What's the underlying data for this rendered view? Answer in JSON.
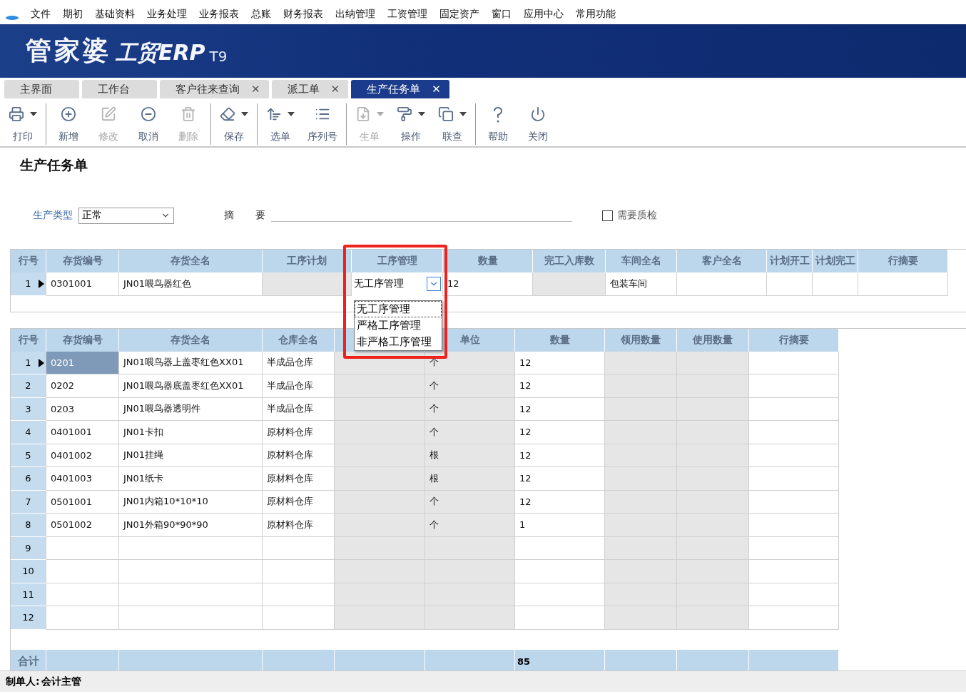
{
  "menu": [
    "文件",
    "期初",
    "基础资料",
    "业务处理",
    "业务报表",
    "总账",
    "财务报表",
    "出纳管理",
    "工资管理",
    "固定资产",
    "窗口",
    "应用中心",
    "常用功能"
  ],
  "banner": {
    "brand": "管家婆",
    "product": "工贸ERP",
    "version": "T9"
  },
  "tabs": [
    {
      "label": "主界面",
      "selected": false
    },
    {
      "label": "工作台",
      "selected": false
    },
    {
      "label": "客户往来查询",
      "selected": false,
      "close": "✕"
    },
    {
      "label": "派工单",
      "selected": false,
      "close": "✕"
    },
    {
      "label": "生产任务单",
      "selected": true,
      "close": "✕"
    }
  ],
  "toolbar": [
    [
      {
        "label": "打印",
        "disabled": false,
        "dropdown": true
      }
    ],
    [
      {
        "label": "新增",
        "disabled": false,
        "dropdown": false
      },
      {
        "label": "修改",
        "disabled": true,
        "dropdown": false
      },
      {
        "label": "取消",
        "disabled": false,
        "dropdown": false
      },
      {
        "label": "删除",
        "disabled": true,
        "dropdown": false
      }
    ],
    [
      {
        "label": "保存",
        "disabled": false,
        "dropdown": true
      }
    ],
    [
      {
        "label": "选单",
        "disabled": false,
        "dropdown": true
      },
      {
        "label": "序列号",
        "disabled": false,
        "dropdown": false
      }
    ],
    [
      {
        "label": "生单",
        "disabled": true,
        "dropdown": true
      },
      {
        "label": "操作",
        "disabled": false,
        "dropdown": true
      },
      {
        "label": "联查",
        "disabled": false,
        "dropdown": true
      }
    ],
    [
      {
        "label": "帮助",
        "disabled": false,
        "dropdown": false
      },
      {
        "label": "关闭",
        "disabled": false,
        "dropdown": false
      }
    ]
  ],
  "page_title": "生产任务单",
  "form": {
    "type_label": "生产类型",
    "type_value": "正常",
    "summary_label_1": "摘",
    "summary_label_2": "要",
    "quality_check": {
      "label": "需要质检",
      "checked": false
    }
  },
  "top_table": {
    "columns": [
      {
        "label": "行号",
        "kind": "no"
      },
      {
        "label": "存货编号",
        "kind": "text"
      },
      {
        "label": "存货全名",
        "kind": "text"
      },
      {
        "label": "工序计划",
        "kind": "readonly"
      },
      {
        "label": "工序管理",
        "kind": "combo"
      },
      {
        "label": "数量",
        "kind": "text"
      },
      {
        "label": "完工入库数",
        "kind": "readonly"
      },
      {
        "label": "车间全名",
        "kind": "text"
      },
      {
        "label": "客户全名",
        "kind": "text"
      },
      {
        "label": "计划开工",
        "kind": "text"
      },
      {
        "label": "计划完工",
        "kind": "text"
      },
      {
        "label": "行摘要",
        "kind": "text"
      }
    ],
    "rows": [
      {
        "current": true,
        "selected": false,
        "cells": [
          "1",
          "0301001",
          "JN01喂鸟器红色",
          "",
          "无工序管理",
          "12",
          "",
          "包装车间",
          "",
          "",
          "",
          ""
        ]
      }
    ],
    "dropdown": [
      {
        "label": "无工序管理",
        "selected": true
      },
      {
        "label": "严格工序管理",
        "selected": false
      },
      {
        "label": "非严格工序管理",
        "selected": false
      }
    ]
  },
  "bottom_table": {
    "columns": [
      {
        "label": "行号",
        "kind": "no"
      },
      {
        "label": "存货编号",
        "kind": "text"
      },
      {
        "label": "存货全名",
        "kind": "text"
      },
      {
        "label": "仓库全名",
        "kind": "text"
      },
      {
        "kind": "readonly"
      },
      {
        "label": "单位",
        "kind": "readonly"
      },
      {
        "label": "数量",
        "kind": "text"
      },
      {
        "label": "领用数量",
        "kind": "readonly"
      },
      {
        "label": "使用数量",
        "kind": "readonly"
      },
      {
        "label": "行摘要",
        "kind": "text"
      }
    ],
    "rows": [
      {
        "current": true,
        "selected": true,
        "cells": [
          "1",
          "0201",
          "JN01喂鸟器上盖枣红色XX01",
          "半成品仓库",
          "",
          "个",
          "12"
        ]
      },
      {
        "current": false,
        "selected": false,
        "cells": [
          "2",
          "0202",
          "JN01喂鸟器底盖枣红色XX01",
          "半成品仓库",
          "",
          "个",
          "12"
        ]
      },
      {
        "current": false,
        "selected": false,
        "cells": [
          "3",
          "0203",
          "JN01喂鸟器透明件",
          "半成品仓库",
          "",
          "个",
          "12"
        ]
      },
      {
        "current": false,
        "selected": false,
        "cells": [
          "4",
          "0401001",
          "JN01卡扣",
          "原材料仓库",
          "",
          "个",
          "12"
        ]
      },
      {
        "current": false,
        "selected": false,
        "cells": [
          "5",
          "0401002",
          "JN01挂绳",
          "原材料仓库",
          "",
          "根",
          "12"
        ]
      },
      {
        "current": false,
        "selected": false,
        "cells": [
          "6",
          "0401003",
          "JN01纸卡",
          "原材料仓库",
          "",
          "根",
          "12"
        ]
      },
      {
        "current": false,
        "selected": false,
        "cells": [
          "7",
          "0501001",
          "JN01内箱10*10*10",
          "原材料仓库",
          "",
          "个",
          "12"
        ]
      },
      {
        "current": false,
        "selected": false,
        "cells": [
          "8",
          "0501002",
          "JN01外箱90*90*90",
          "原材料仓库",
          "",
          "个",
          "1"
        ]
      },
      {
        "current": false,
        "selected": false,
        "cells": [
          "9"
        ]
      },
      {
        "current": false,
        "selected": false,
        "cells": [
          "10"
        ]
      },
      {
        "current": false,
        "selected": false,
        "cells": [
          "11"
        ]
      },
      {
        "current": false,
        "selected": false,
        "cells": [
          "12"
        ]
      }
    ],
    "total": {
      "label": "合计",
      "quantity": "85"
    }
  },
  "status_bar": {
    "label": "制单人:",
    "value": "会计主管"
  }
}
